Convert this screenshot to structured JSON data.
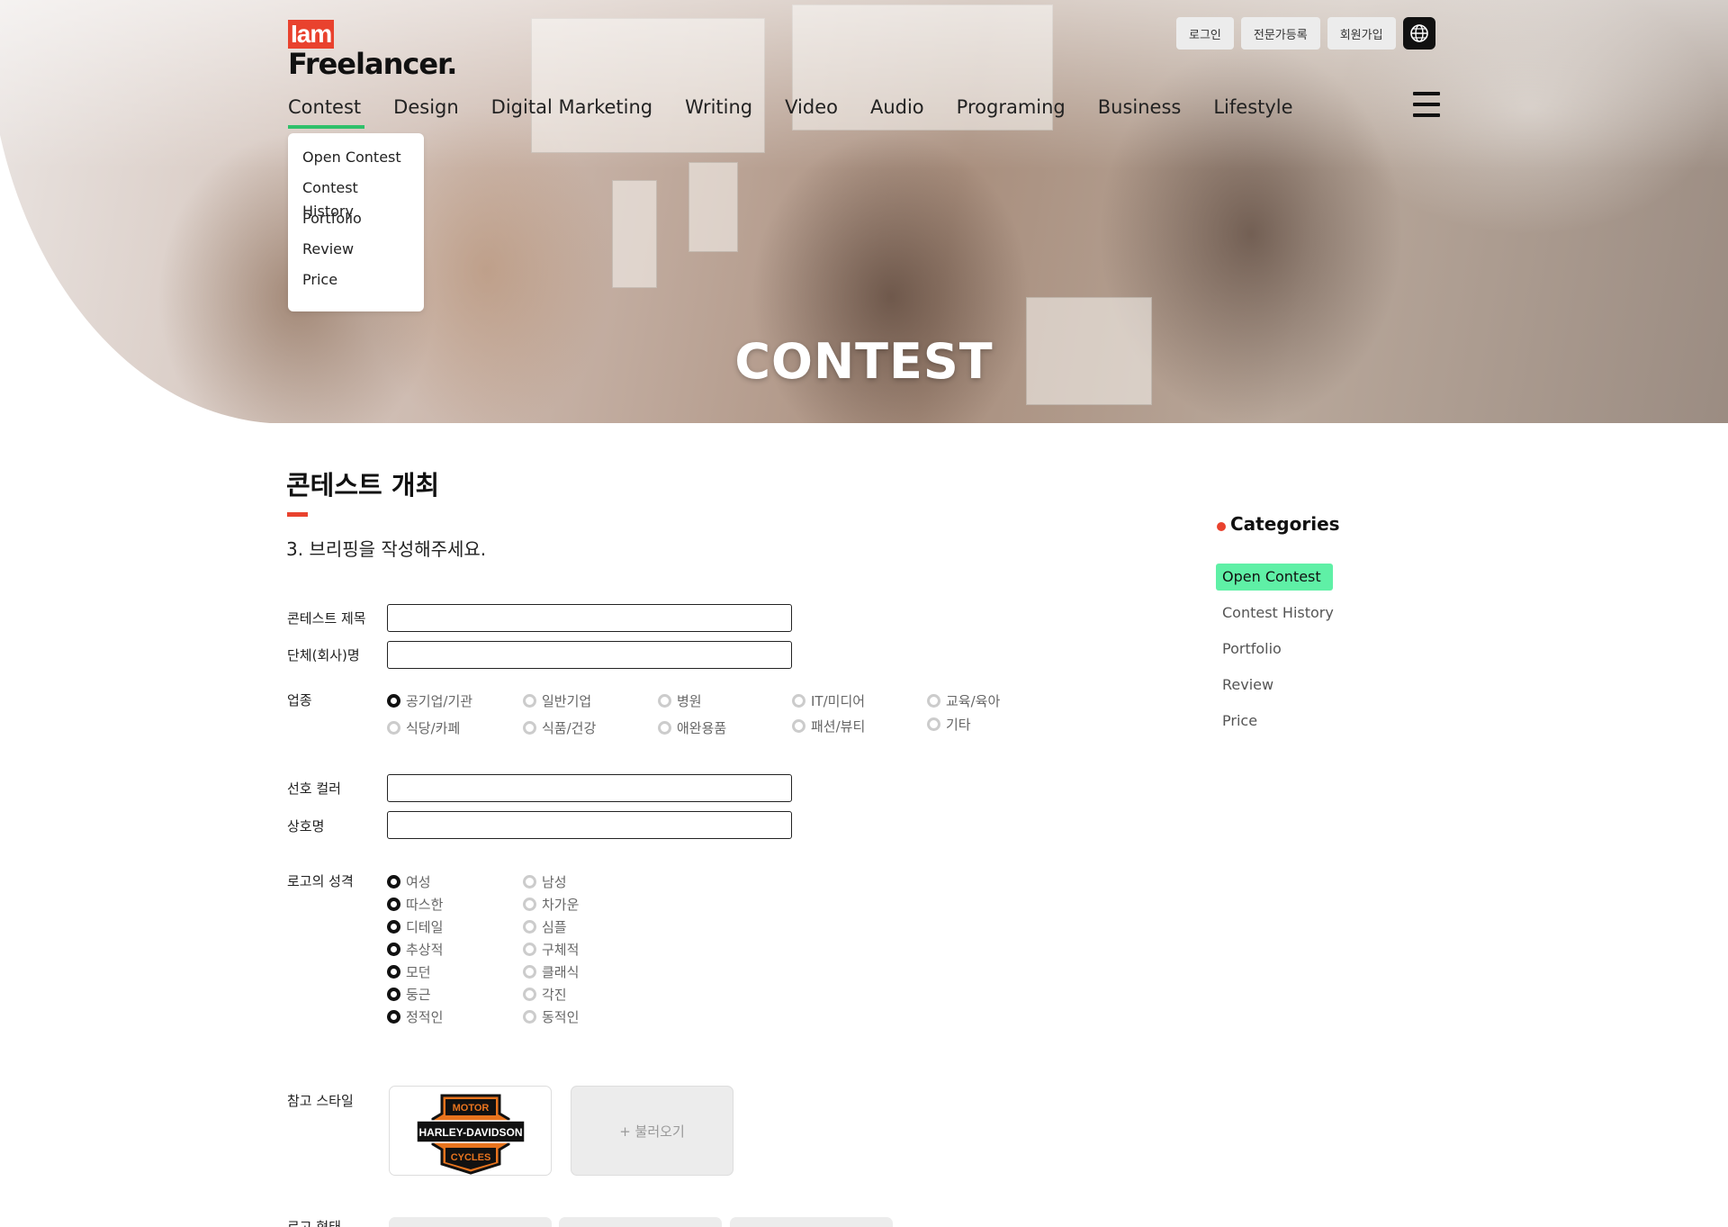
{
  "header": {
    "logo_top": "Iam",
    "logo_bottom": "Freelancer.",
    "top_buttons": {
      "login": "로그인",
      "expert_register": "전문가등록",
      "signup": "회원가입"
    },
    "nav": [
      "Contest",
      "Design",
      "Digital Marketing",
      "Writing",
      "Video",
      "Audio",
      "Programing",
      "Business",
      "Lifestyle"
    ],
    "dropdown": [
      "Open Contest",
      "Contest History",
      "Portfolio",
      "Review",
      "Price"
    ]
  },
  "hero": {
    "title": "CONTEST"
  },
  "main": {
    "title": "콘테스트 개최",
    "step": "3. 브리핑을 작성해주세요.",
    "labels": {
      "contest_title": "콘테스트 제목",
      "org_name": "단체(회사)명",
      "industry": "업종",
      "pref_color": "선호 컬러",
      "brand_name": "상호명",
      "logo_character": "로고의 성격",
      "reference_style": "참고 스타일",
      "logo_form": "로고 형태"
    },
    "industry_options": [
      "공기업/기관",
      "일반기업",
      "병원",
      "IT/미디어",
      "교육/육아",
      "식당/카페",
      "식품/건강",
      "애완용품",
      "패션/뷰티",
      "기타"
    ],
    "character_left": [
      "여성",
      "따스한",
      "디테일",
      "추상적",
      "모던",
      "둥근",
      "정적인"
    ],
    "character_right": [
      "남성",
      "차가운",
      "심플",
      "구체적",
      "클래식",
      "각진",
      "동적인"
    ],
    "reference_logo_text": [
      "MOTOR",
      "HARLEY-DAVIDSON",
      "CYCLES"
    ],
    "add_button": "+ 불러오기"
  },
  "sidebar": {
    "title": "Categories",
    "items": [
      "Open Contest",
      "Contest History",
      "Portfolio",
      "Review",
      "Price"
    ]
  },
  "colors": {
    "accent_red": "#e9422e",
    "accent_green": "#2fc06a",
    "active_bg": "#5ff0a6"
  }
}
